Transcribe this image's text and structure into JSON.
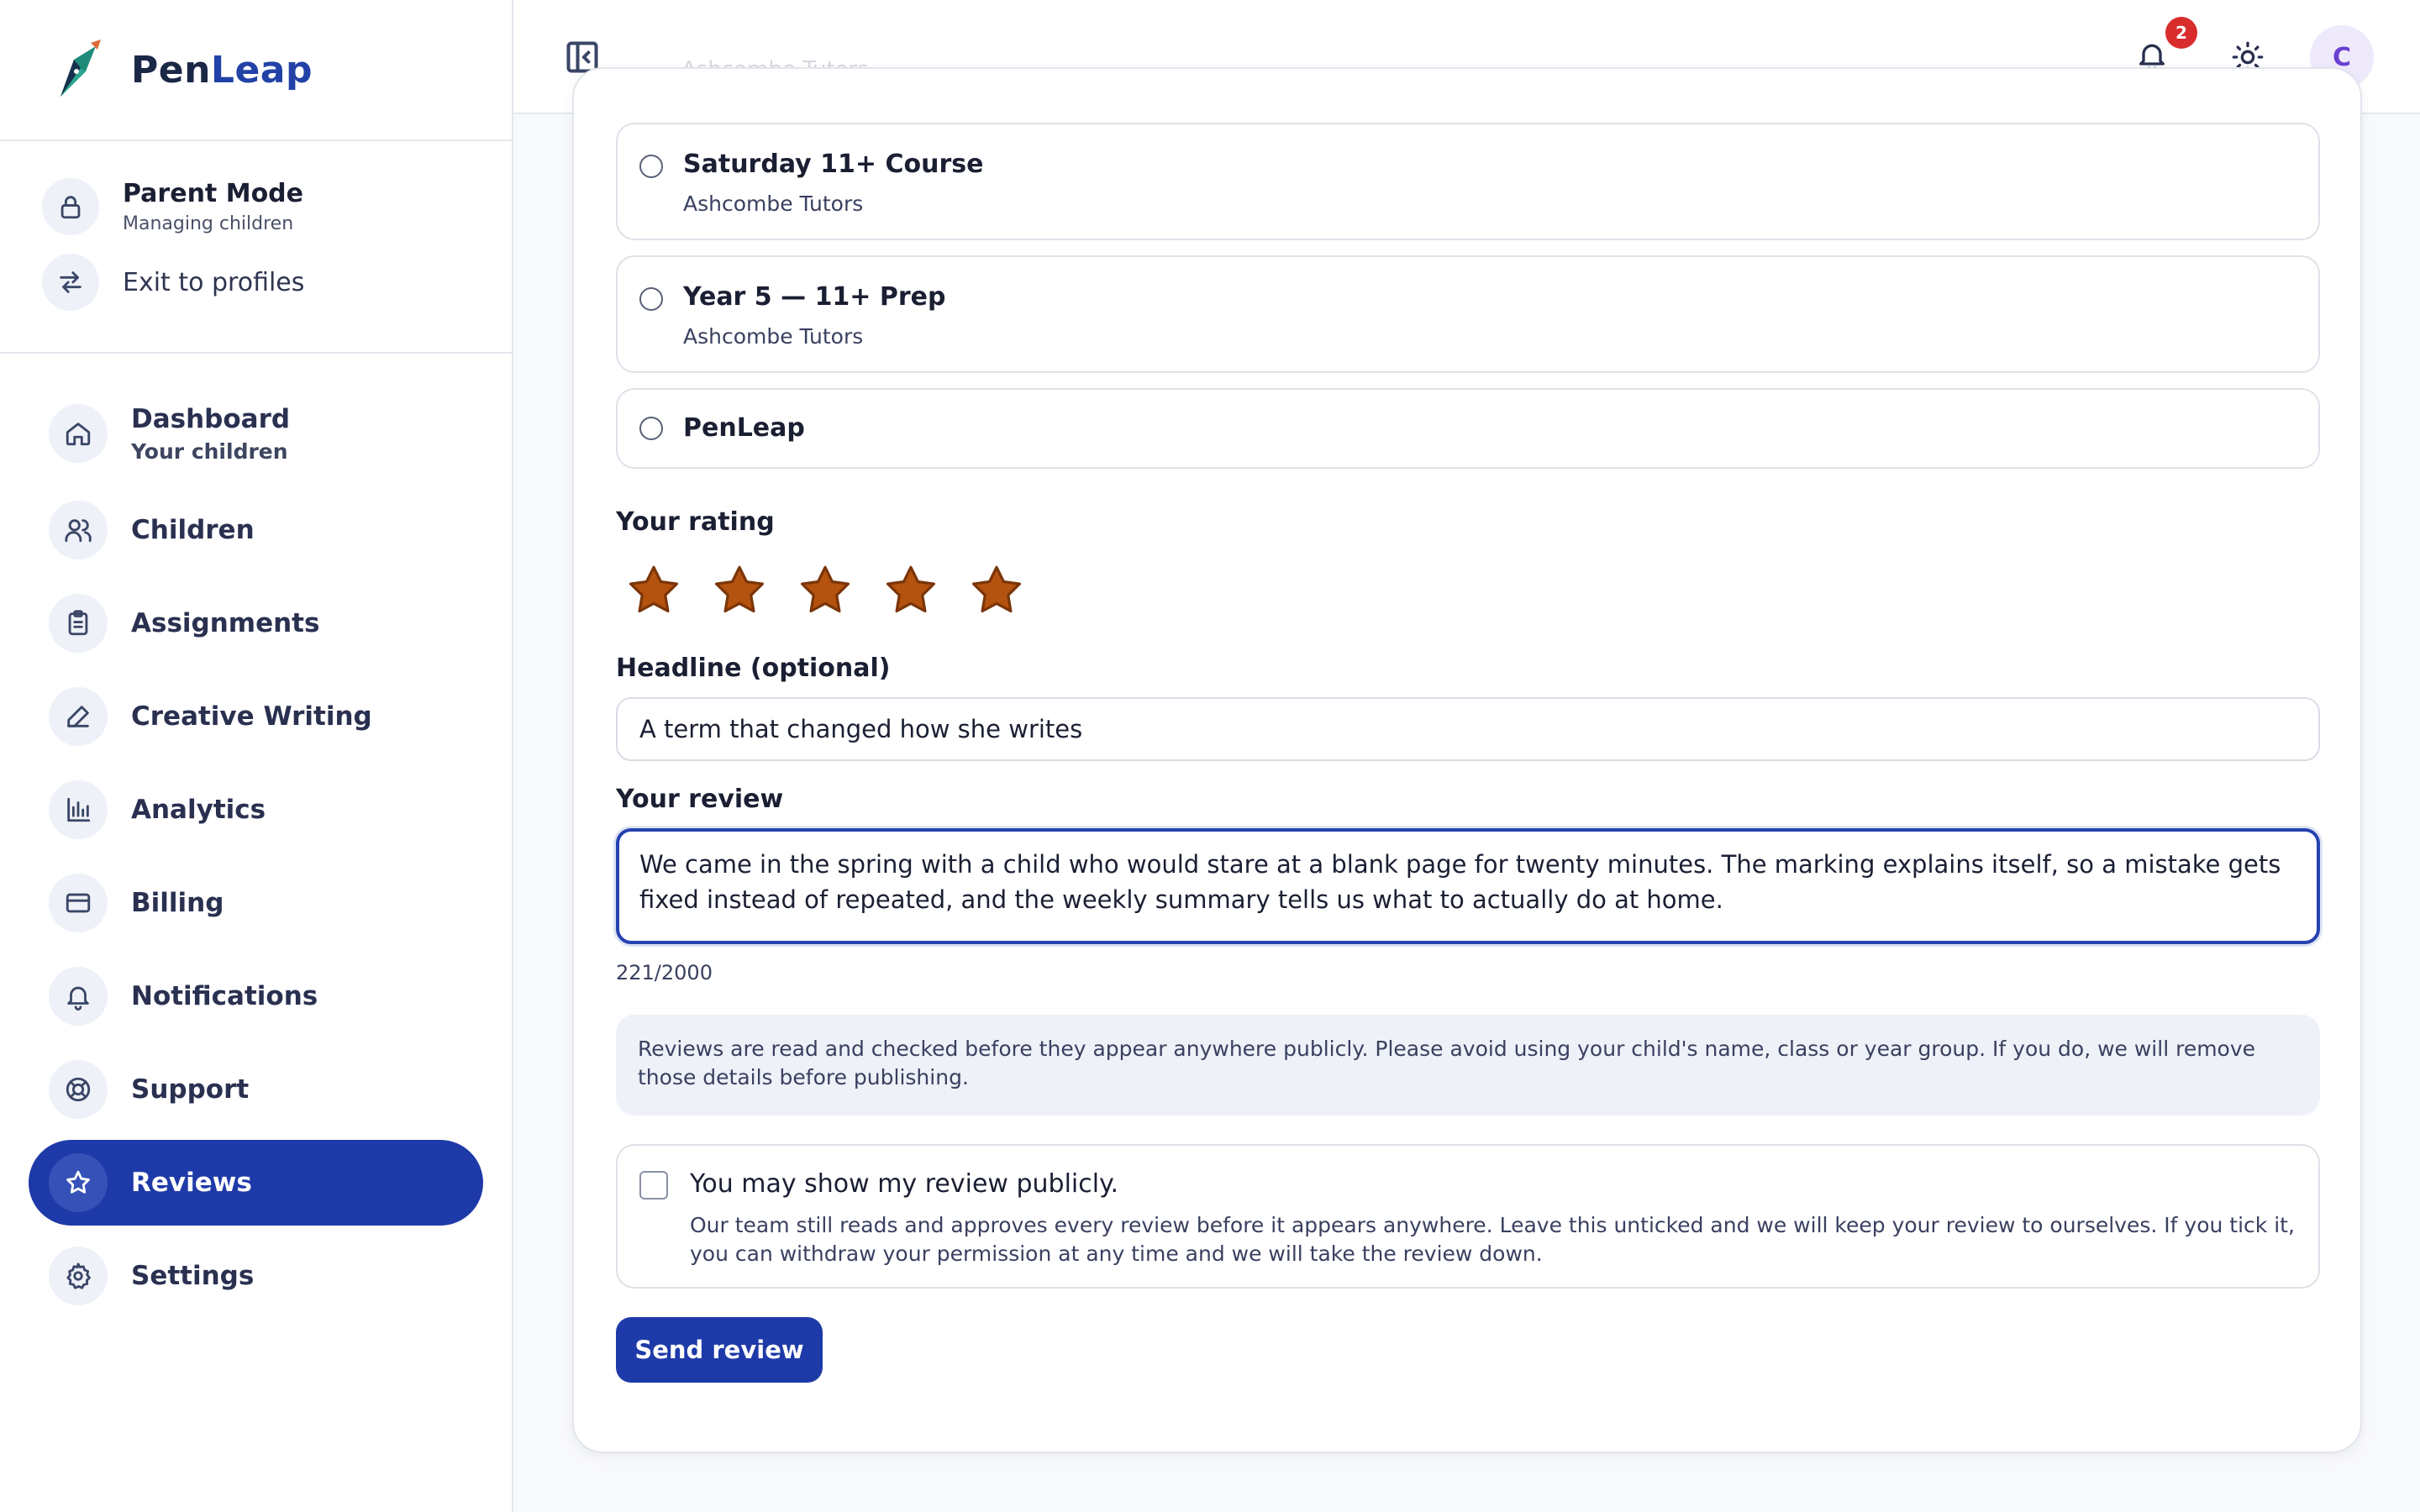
{
  "brand": {
    "name_part1": "Pen",
    "name_part2": "Leap"
  },
  "mode": {
    "title": "Parent Mode",
    "subtitle": "Managing children",
    "exit_label": "Exit to profiles"
  },
  "nav": {
    "items": [
      {
        "label": "Dashboard",
        "sub": "Your children",
        "icon": "home-icon"
      },
      {
        "label": "Children",
        "icon": "users-icon"
      },
      {
        "label": "Assignments",
        "icon": "clipboard-icon"
      },
      {
        "label": "Creative Writing",
        "icon": "pen-icon"
      },
      {
        "label": "Analytics",
        "icon": "bar-chart-icon"
      },
      {
        "label": "Billing",
        "icon": "credit-card-icon"
      },
      {
        "label": "Notifications",
        "icon": "bell-icon"
      },
      {
        "label": "Support",
        "icon": "lifebuoy-icon"
      },
      {
        "label": "Reviews",
        "icon": "star-icon",
        "active": true
      },
      {
        "label": "Settings",
        "icon": "gear-icon"
      }
    ]
  },
  "topbar": {
    "ghost_text": "Ashcombe Tutors",
    "notification_count": "2",
    "avatar_initial": "C"
  },
  "form": {
    "options": [
      {
        "title": "Saturday 11+ Course",
        "provider": "Ashcombe Tutors"
      },
      {
        "title": "Year 5 — 11+ Prep",
        "provider": "Ashcombe Tutors"
      },
      {
        "title": "PenLeap"
      }
    ],
    "rating_label": "Your rating",
    "rating_value": 5,
    "rating_max": 5,
    "star_color": "#b4520f",
    "headline_label": "Headline (optional)",
    "headline_value": "A term that changed how she writes",
    "review_label": "Your review",
    "review_value": "We came in the spring with a child who would stare at a blank page for twenty minutes. The marking explains itself, so a mistake gets fixed instead of repeated, and the weekly summary tells us what to actually do at home.",
    "counter": "221/2000",
    "notice": "Reviews are read and checked before they appear anywhere publicly. Please avoid using your child's name, class or year group. If you do, we will remove those details before publishing.",
    "consent_title": "You may show my review publicly.",
    "consent_desc": "Our team still reads and approves every review before it appears anywhere. Leave this unticked and we will keep your review to ourselves. If you tick it, you can withdraw your permission at any time and we will take the review down.",
    "consent_checked": false,
    "submit_label": "Send review"
  },
  "colors": {
    "accent": "#1e3aa8",
    "badge": "#d92d2d",
    "avatar_bg": "#eee9fb",
    "avatar_fg": "#6a3fd0"
  }
}
